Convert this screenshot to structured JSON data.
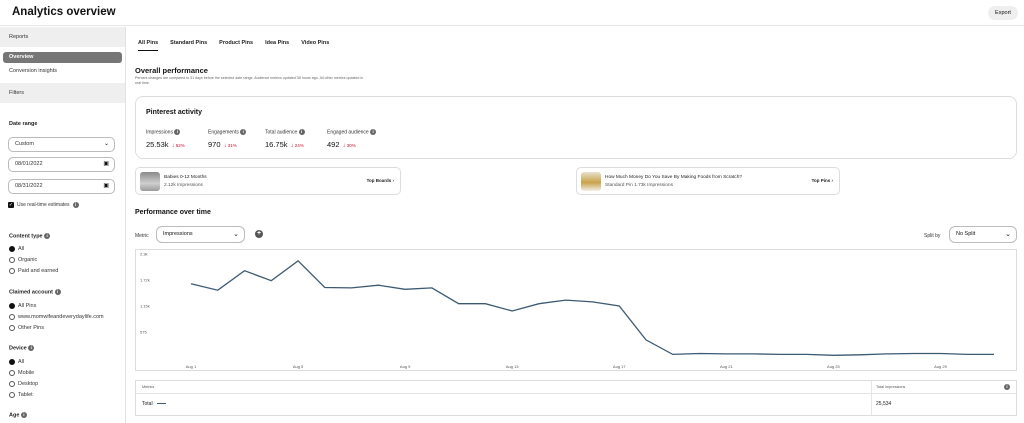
{
  "header": {
    "title": "Analytics overview",
    "export_label": "Export"
  },
  "sidebar": {
    "reports_heading": "Reports",
    "reports": [
      {
        "label": "Overview",
        "active": true
      },
      {
        "label": "Conversion insights",
        "active": false
      }
    ],
    "filters_heading": "Filters",
    "date_range_label": "Date range",
    "date_range_select": "Custom",
    "start_date": "08/01/2022",
    "end_date": "08/31/2022",
    "real_time_label": "Use real-time estimates",
    "content_type_label": "Content type",
    "content_type_options": [
      "All",
      "Organic",
      "Paid and earned"
    ],
    "claimed_account_label": "Claimed account",
    "claimed_account_options": [
      "All Pins",
      "www.momwifeandeverydaylife.com",
      "Other Pins"
    ],
    "device_label": "Device",
    "device_options": [
      "All",
      "Mobile",
      "Desktop",
      "Tablet"
    ],
    "age_label": "Age"
  },
  "tabs": [
    "All Pins",
    "Standard Pins",
    "Product Pins",
    "Idea Pins",
    "Video Pins"
  ],
  "overall": {
    "title": "Overall performance",
    "subtitle": "Percent changes are compared to 31 days before the selected date range. Audience metrics updated 38 hours ago. All other metrics updated in real time."
  },
  "activity": {
    "title": "Pinterest activity",
    "metrics": [
      {
        "label": "Impressions",
        "value": "25.53k",
        "change": "52%"
      },
      {
        "label": "Engagements",
        "value": "970",
        "change": "31%"
      },
      {
        "label": "Total audience",
        "value": "16.75k",
        "change": "24%"
      },
      {
        "label": "Engaged audience",
        "value": "492",
        "change": "30%"
      }
    ]
  },
  "top_board": {
    "title": "Babies 0-12 Months",
    "sub": "2.12k Impressions",
    "link": "Top Boards"
  },
  "top_pin": {
    "title": "How Much Money Do You Save By Making Foods from Scratch?",
    "sub": "Standard Pin   1.73k Impressions",
    "link": "Top Pins"
  },
  "performance": {
    "title": "Performance over time",
    "metric_label": "Metric",
    "metric_value": "Impressions",
    "split_label": "Split by",
    "split_value": "No Split"
  },
  "chart_data": {
    "type": "line",
    "x_tick_labels": [
      "Aug 1",
      "Aug 5",
      "Aug 9",
      "Aug 13",
      "Aug 17",
      "Aug 21",
      "Aug 25",
      "Aug 29"
    ],
    "y_tick_labels": [
      "2.3k",
      "1.72k",
      "1.15k",
      "575"
    ],
    "ylim": [
      0,
      2300
    ],
    "grid": false,
    "series": [
      {
        "name": "Total",
        "x": [
          "Aug 1",
          "Aug 2",
          "Aug 3",
          "Aug 4",
          "Aug 5",
          "Aug 6",
          "Aug 7",
          "Aug 8",
          "Aug 9",
          "Aug 10",
          "Aug 11",
          "Aug 12",
          "Aug 13",
          "Aug 14",
          "Aug 15",
          "Aug 16",
          "Aug 17",
          "Aug 18",
          "Aug 19",
          "Aug 20",
          "Aug 21",
          "Aug 22",
          "Aug 23",
          "Aug 24",
          "Aug 25",
          "Aug 26",
          "Aug 27",
          "Aug 28",
          "Aug 29",
          "Aug 30",
          "Aug 31"
        ],
        "values": [
          1640,
          1500,
          1930,
          1710,
          2150,
          1560,
          1550,
          1610,
          1520,
          1550,
          1200,
          1200,
          1040,
          1200,
          1280,
          1240,
          1150,
          400,
          80,
          100,
          90,
          90,
          80,
          80,
          60,
          70,
          90,
          100,
          100,
          80,
          80
        ]
      }
    ],
    "color": "#3d5a73"
  },
  "table": {
    "col_metrics": "Metrics",
    "col_total": "Total impressions",
    "row_label": "Total",
    "row_value": "25,534"
  }
}
